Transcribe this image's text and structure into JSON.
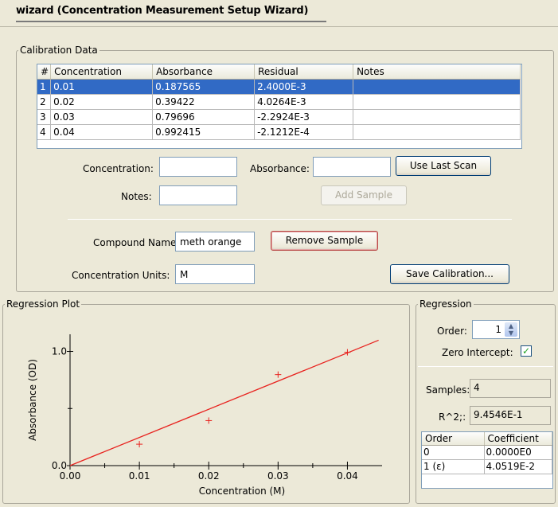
{
  "window": {
    "title": "wizard (Concentration Measurement Setup Wizard)"
  },
  "calibration": {
    "legend": "Calibration Data",
    "columns": [
      "#",
      "Concentration",
      "Absorbance",
      "Residual",
      "Notes"
    ],
    "rows": [
      {
        "n": "1",
        "conc": "0.01",
        "abs": "0.187565",
        "res": "2.4000E-3",
        "notes": "",
        "selected": true
      },
      {
        "n": "2",
        "conc": "0.02",
        "abs": "0.39422",
        "res": "4.0264E-3",
        "notes": ""
      },
      {
        "n": "3",
        "conc": "0.03",
        "abs": "0.79696",
        "res": "-2.2924E-3",
        "notes": ""
      },
      {
        "n": "4",
        "conc": "0.04",
        "abs": "0.992415",
        "res": "-2.1212E-4",
        "notes": ""
      }
    ],
    "concentration_label": "Concentration:",
    "concentration_value": "",
    "absorbance_label": "Absorbance:",
    "absorbance_value": "",
    "use_last_scan": "Use Last Scan",
    "notes_label": "Notes:",
    "notes_value": "",
    "add_sample": "Add Sample",
    "compound_label": "Compound Name",
    "compound_value": "meth orange",
    "remove_sample": "Remove Sample",
    "units_label": "Concentration Units:",
    "units_value": "M",
    "save_calibration": "Save Calibration..."
  },
  "plot": {
    "legend": "Regression Plot"
  },
  "regression": {
    "legend": "Regression",
    "order_label": "Order:",
    "order_value": "1",
    "zero_intercept_label": "Zero Intercept:",
    "zero_intercept_checked": true,
    "samples_label": "Samples:",
    "samples_value": "4",
    "r2_label": "R^2;:",
    "r2_value": "9.4546E-1",
    "coef_columns": [
      "Order",
      "Coefficient"
    ],
    "coef_rows": [
      {
        "order": "0",
        "coef": "0.0000E0"
      },
      {
        "order": "1 (ε)",
        "coef": "4.0519E-2"
      }
    ]
  },
  "chart_data": {
    "type": "scatter",
    "xlabel": "Concentration (M)",
    "ylabel": "Absorbance (OD)",
    "xlim": [
      0.0,
      0.045
    ],
    "ylim": [
      0.0,
      1.15
    ],
    "x_ticks": [
      "0.00",
      "0.01",
      "0.02",
      "0.03",
      "0.04"
    ],
    "x_tick_values": [
      0.0,
      0.01,
      0.02,
      0.03,
      0.04
    ],
    "y_ticks": [
      "0.0",
      "1.0"
    ],
    "y_tick_values": [
      0.0,
      1.0
    ],
    "points": [
      {
        "x": 0.01,
        "y": 0.187565
      },
      {
        "x": 0.02,
        "y": 0.39422
      },
      {
        "x": 0.03,
        "y": 0.79696
      },
      {
        "x": 0.04,
        "y": 0.992415
      }
    ],
    "fit_line": {
      "slope": 24.68,
      "intercept": 0.0
    },
    "colors": {
      "points": "#e8231f",
      "line": "#e8231f"
    }
  }
}
